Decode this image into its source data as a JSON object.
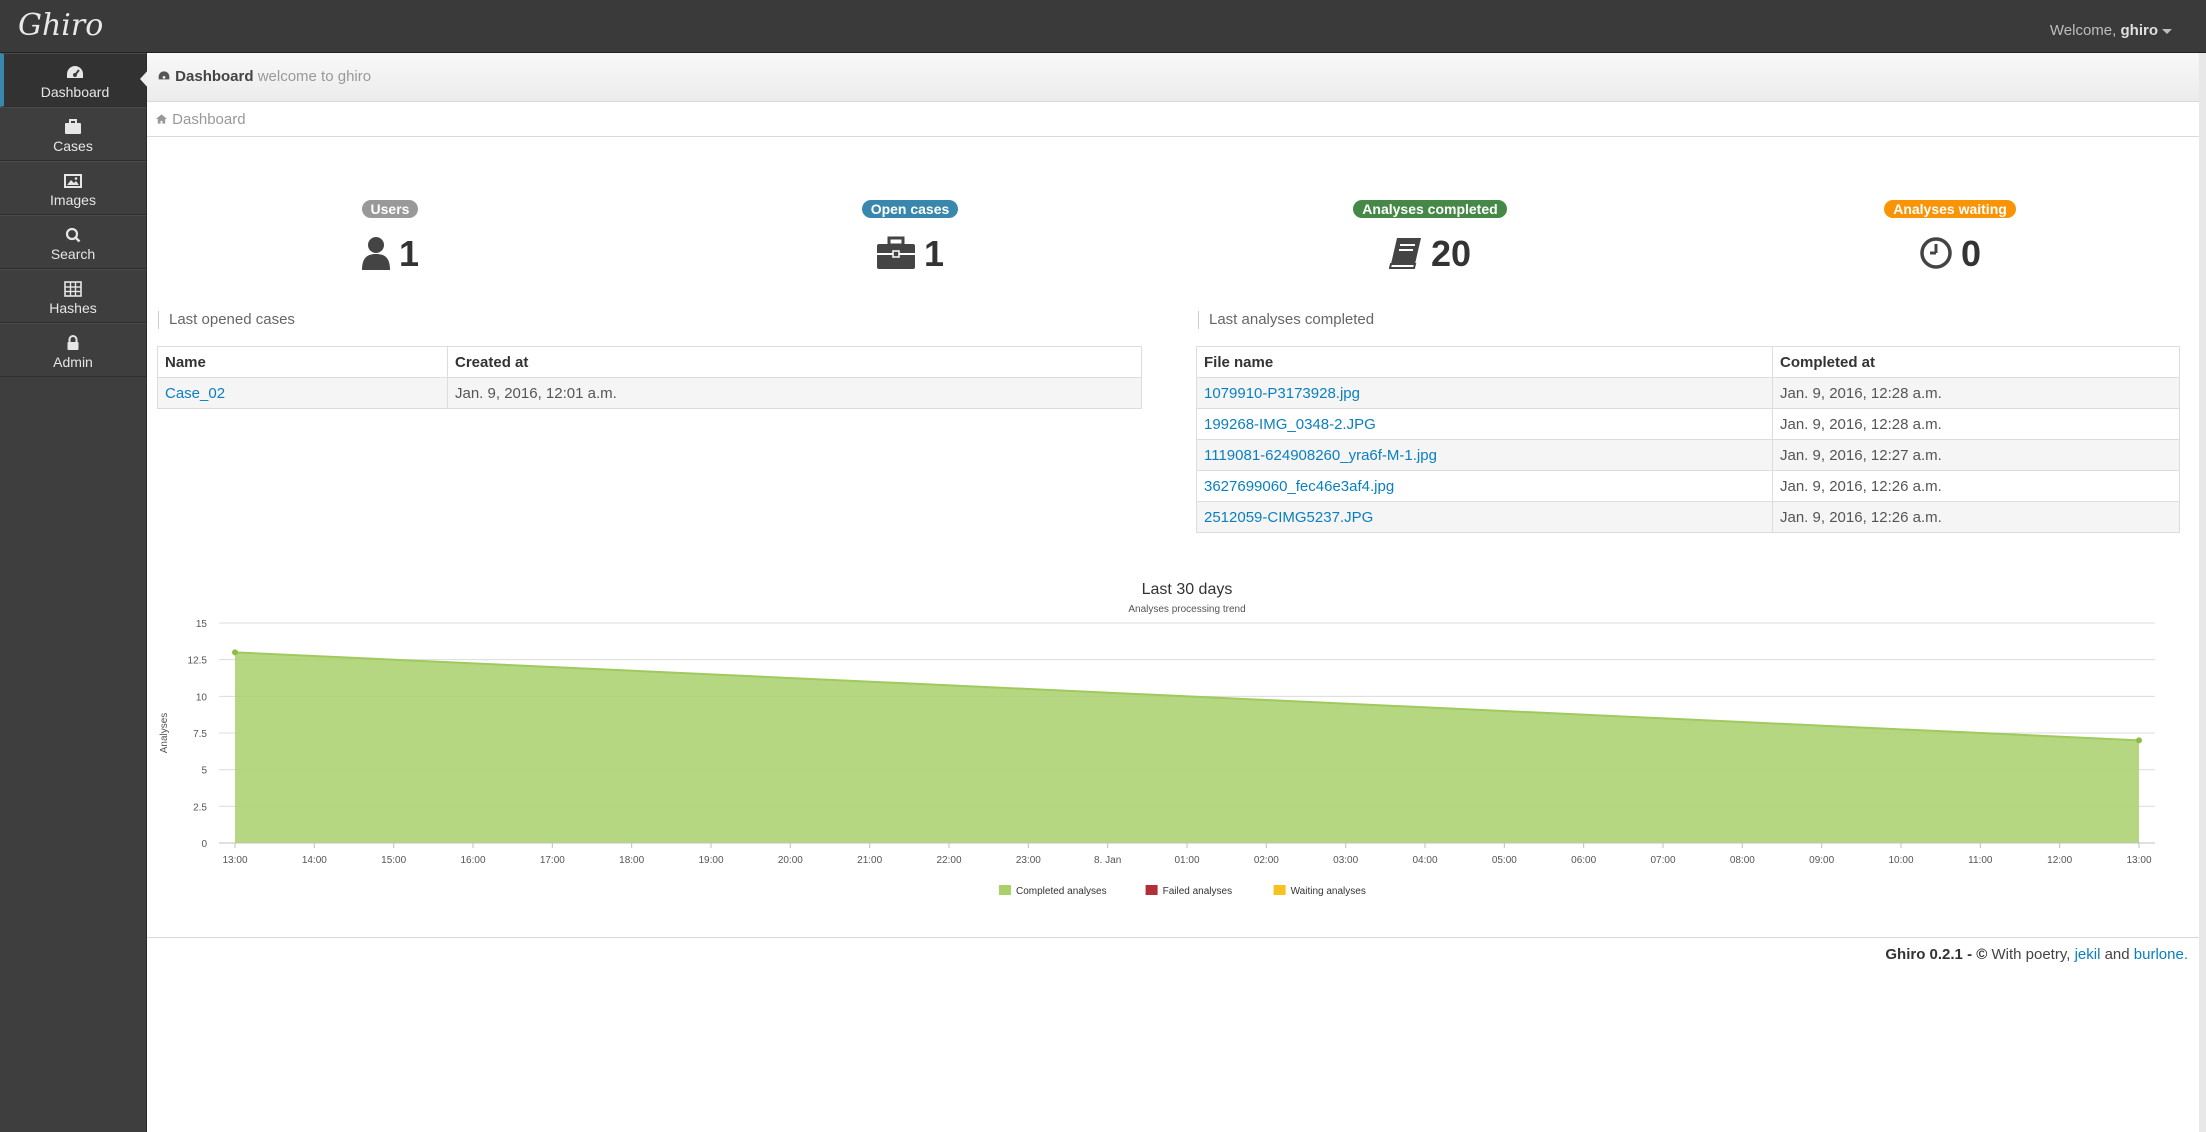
{
  "app": {
    "logo": "Ghiro",
    "welcome_prefix": "Welcome,",
    "user": "ghiro"
  },
  "sidebar": {
    "items": [
      {
        "label": "Dashboard",
        "icon": "dashboard-icon",
        "active": true
      },
      {
        "label": "Cases",
        "icon": "briefcase-icon"
      },
      {
        "label": "Images",
        "icon": "picture-icon"
      },
      {
        "label": "Search",
        "icon": "search-icon"
      },
      {
        "label": "Hashes",
        "icon": "table-icon"
      },
      {
        "label": "Admin",
        "icon": "lock-icon"
      }
    ]
  },
  "header": {
    "title": "Dashboard",
    "subtitle": "welcome to ghiro"
  },
  "breadcrumb": {
    "label": "Dashboard"
  },
  "stats": [
    {
      "label": "Users",
      "value": "1",
      "color": "#999999",
      "icon": "user-icon"
    },
    {
      "label": "Open cases",
      "value": "1",
      "color": "#3a87ad",
      "icon": "briefcase-icon"
    },
    {
      "label": "Analyses completed",
      "value": "20",
      "color": "#468847",
      "icon": "book-icon"
    },
    {
      "label": "Analyses waiting",
      "value": "0",
      "color": "#f89406",
      "icon": "clock-icon"
    }
  ],
  "last_cases": {
    "title": "Last opened cases",
    "columns": [
      "Name",
      "Created at"
    ],
    "rows": [
      {
        "name": "Case_02",
        "created": "Jan. 9, 2016, 12:01 a.m."
      }
    ]
  },
  "last_analyses": {
    "title": "Last analyses completed",
    "columns": [
      "File name",
      "Completed at"
    ],
    "rows": [
      {
        "file": "1079910-P3173928.jpg",
        "completed": "Jan. 9, 2016, 12:28 a.m."
      },
      {
        "file": "199268-IMG_0348-2.JPG",
        "completed": "Jan. 9, 2016, 12:28 a.m."
      },
      {
        "file": "1119081-624908260_yra6f-M-1.jpg",
        "completed": "Jan. 9, 2016, 12:27 a.m."
      },
      {
        "file": "3627699060_fec46e3af4.jpg",
        "completed": "Jan. 9, 2016, 12:26 a.m."
      },
      {
        "file": "2512059-CIMG5237.JPG",
        "completed": "Jan. 9, 2016, 12:26 a.m."
      }
    ]
  },
  "chart_data": {
    "type": "area",
    "title": "Last 30 days",
    "subtitle": "Analyses processing trend",
    "xlabel": "",
    "ylabel": "Analyses",
    "ylim": [
      0,
      15
    ],
    "yticks": [
      "0",
      "2.5",
      "5",
      "7.5",
      "10",
      "12.5",
      "15"
    ],
    "x_tick_labels": [
      "13:00",
      "14:00",
      "15:00",
      "16:00",
      "17:00",
      "18:00",
      "19:00",
      "20:00",
      "21:00",
      "22:00",
      "23:00",
      "8. Jan",
      "01:00",
      "02:00",
      "03:00",
      "04:00",
      "05:00",
      "06:00",
      "07:00",
      "08:00",
      "09:00",
      "10:00",
      "11:00",
      "12:00",
      "13:00"
    ],
    "grid": true,
    "legend_position": "bottom",
    "series": [
      {
        "name": "Completed analyses",
        "color": "#a9d06b",
        "points": [
          {
            "x_index": 0,
            "y": 13
          },
          {
            "x_index": 24,
            "y": 7
          }
        ]
      },
      {
        "name": "Failed analyses",
        "color": "#b32e37",
        "points": []
      },
      {
        "name": "Waiting analyses",
        "color": "#f7c21d",
        "points": []
      }
    ]
  },
  "footer": {
    "brand": "Ghiro 0.2.1 - ©",
    "text": "With poetry,",
    "link1": "jekil",
    "and": "and",
    "link2": "burlone."
  }
}
